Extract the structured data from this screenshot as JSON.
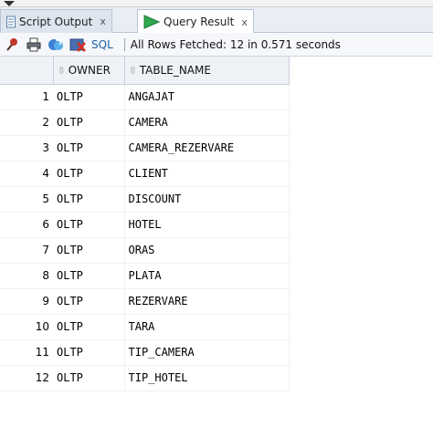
{
  "tabs": [
    {
      "label": "Script Output",
      "close": "x"
    },
    {
      "label": "Query Result",
      "close": "x"
    }
  ],
  "toolbar": {
    "sql_label": "SQL",
    "status": "All Rows Fetched: 12 in 0.571 seconds",
    "icons": [
      "pin-icon",
      "print-icon",
      "refresh-icon",
      "clear-icon"
    ]
  },
  "grid": {
    "columns": [
      "OWNER",
      "TABLE_NAME"
    ],
    "rows": [
      {
        "n": "1",
        "owner": "OLTP",
        "table": "ANGAJAT"
      },
      {
        "n": "2",
        "owner": "OLTP",
        "table": "CAMERA"
      },
      {
        "n": "3",
        "owner": "OLTP",
        "table": "CAMERA_REZERVARE"
      },
      {
        "n": "4",
        "owner": "OLTP",
        "table": "CLIENT"
      },
      {
        "n": "5",
        "owner": "OLTP",
        "table": "DISCOUNT"
      },
      {
        "n": "6",
        "owner": "OLTP",
        "table": "HOTEL"
      },
      {
        "n": "7",
        "owner": "OLTP",
        "table": "ORAS"
      },
      {
        "n": "8",
        "owner": "OLTP",
        "table": "PLATA"
      },
      {
        "n": "9",
        "owner": "OLTP",
        "table": "REZERVARE"
      },
      {
        "n": "10",
        "owner": "OLTP",
        "table": "TARA"
      },
      {
        "n": "11",
        "owner": "OLTP",
        "table": "TIP_CAMERA"
      },
      {
        "n": "12",
        "owner": "OLTP",
        "table": "TIP_HOTEL"
      }
    ]
  },
  "colors": {
    "run_green": "#2fa84f",
    "sql_blue": "#1f5fa8"
  }
}
